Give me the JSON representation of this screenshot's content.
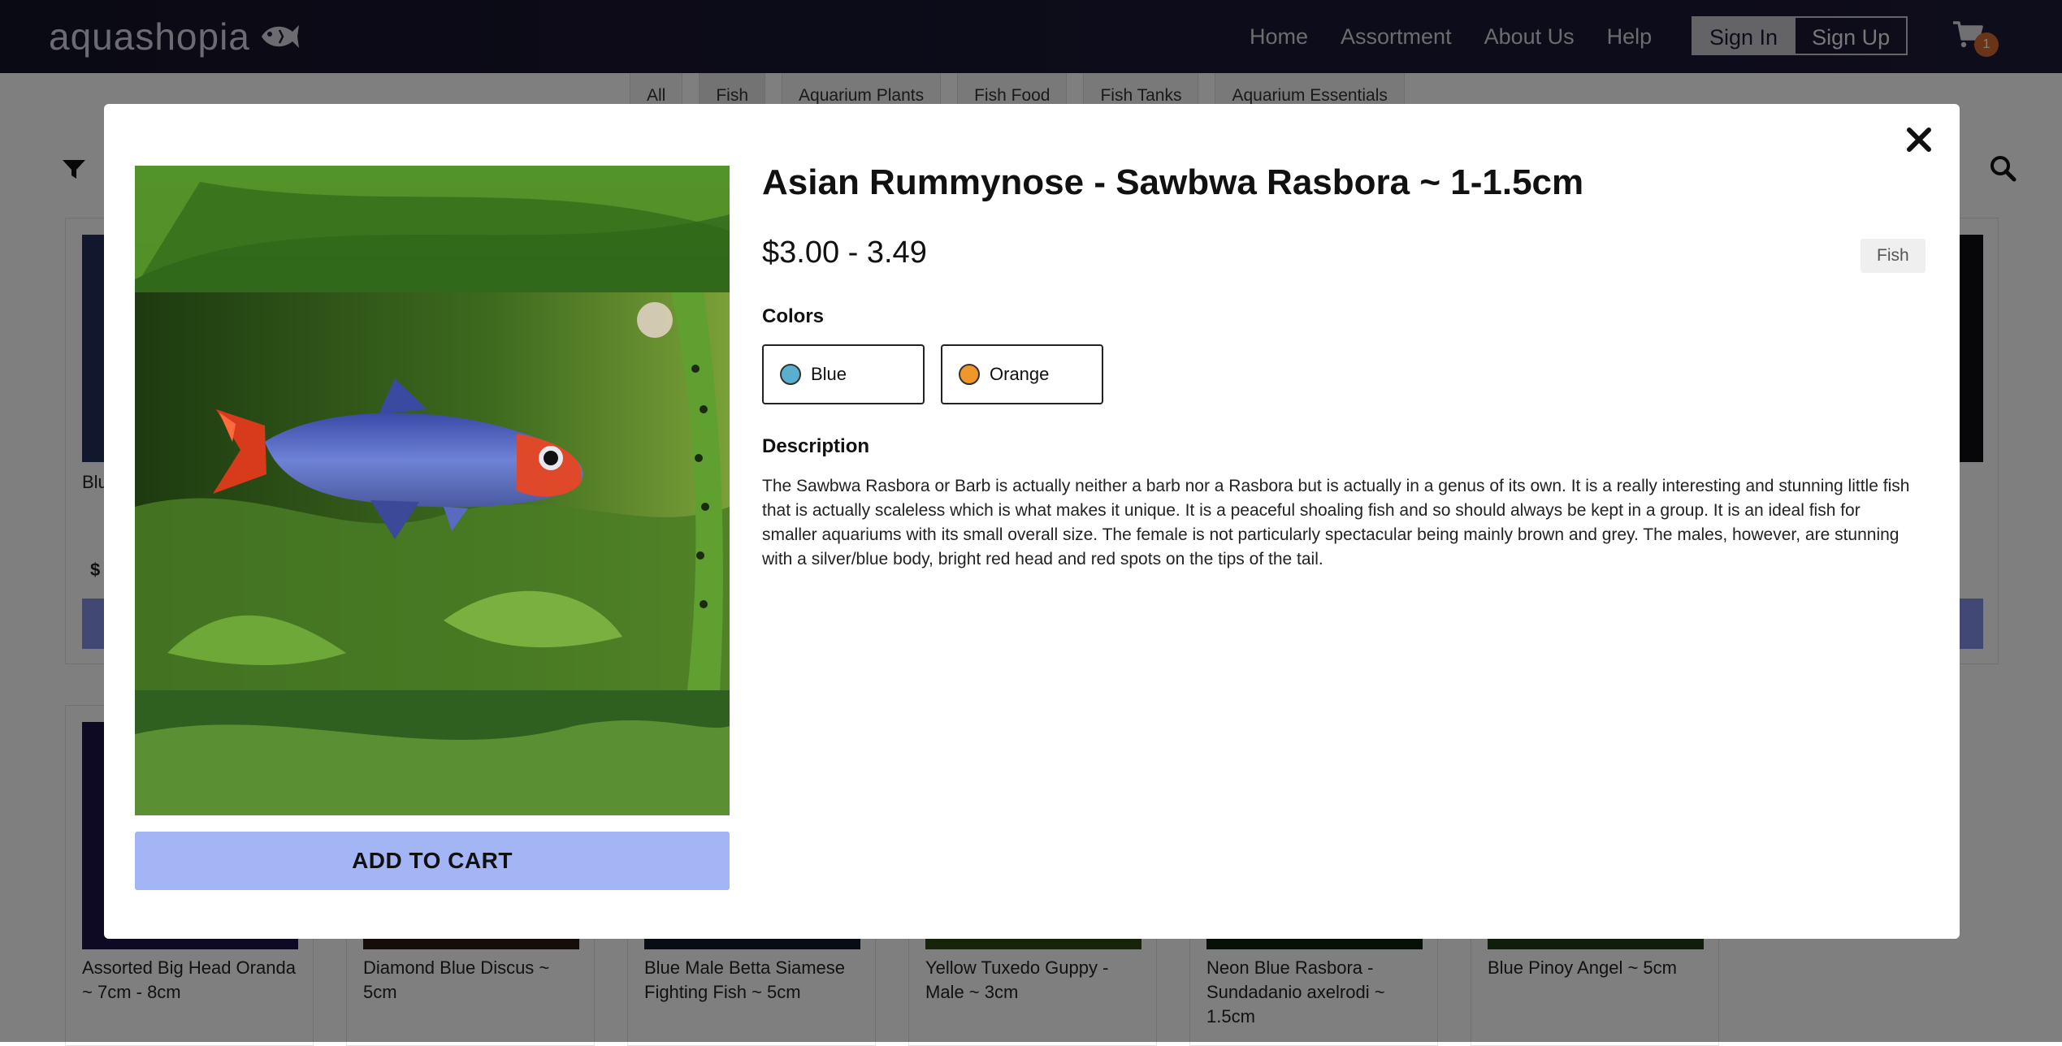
{
  "header": {
    "brand": "aquashopia",
    "nav": [
      "Home",
      "Assortment",
      "About Us",
      "Help"
    ],
    "sign_in": "Sign In",
    "sign_up": "Sign Up",
    "cart_count": "1"
  },
  "categories": [
    "All",
    "Fish",
    "Aquarium Plants",
    "Fish Food",
    "Fish Tanks",
    "Aquarium Essentials"
  ],
  "background_products": {
    "row1_left_name": "Blu",
    "row1_left_price": "$",
    "row2": [
      "Assorted Big Head Oranda ~ 7cm - 8cm",
      "Diamond Blue Discus ~ 5cm",
      "Blue Male Betta Siamese Fighting Fish ~ 5cm",
      "Yellow Tuxedo Guppy - Male ~ 3cm",
      "Neon Blue Rasbora - Sundadanio axelrodi ~ 1.5cm",
      "Blue Pinoy Angel ~ 5cm"
    ]
  },
  "modal": {
    "title": "Asian Rummynose - Sawbwa Rasbora ~ 1-1.5cm",
    "price": "$3.00 - 3.49",
    "category": "Fish",
    "colors_heading": "Colors",
    "colors": [
      {
        "label": "Blue",
        "hex": "#5aaed0"
      },
      {
        "label": "Orange",
        "hex": "#f0962a"
      }
    ],
    "description_heading": "Description",
    "description": "The Sawbwa Rasbora or Barb is actually neither a barb nor a Rasbora but is actually in a genus of its own. It is a really interesting and stunning little fish that is actually scaleless which is what makes it unique. It is a peaceful shoaling fish and so should always be kept in a group. It is an ideal fish for smaller aquariums with its small overall size. The female is not particularly spectacular being mainly brown and grey. The males, however, are stunning with a silver/blue body, bright red head and red spots on the tips of the tail.",
    "add_to_cart": "ADD TO CART"
  },
  "theme": {
    "nav_bg": "#1a1834",
    "accent_button": "#a4b5f6",
    "cart_badge": "#d2692e"
  }
}
